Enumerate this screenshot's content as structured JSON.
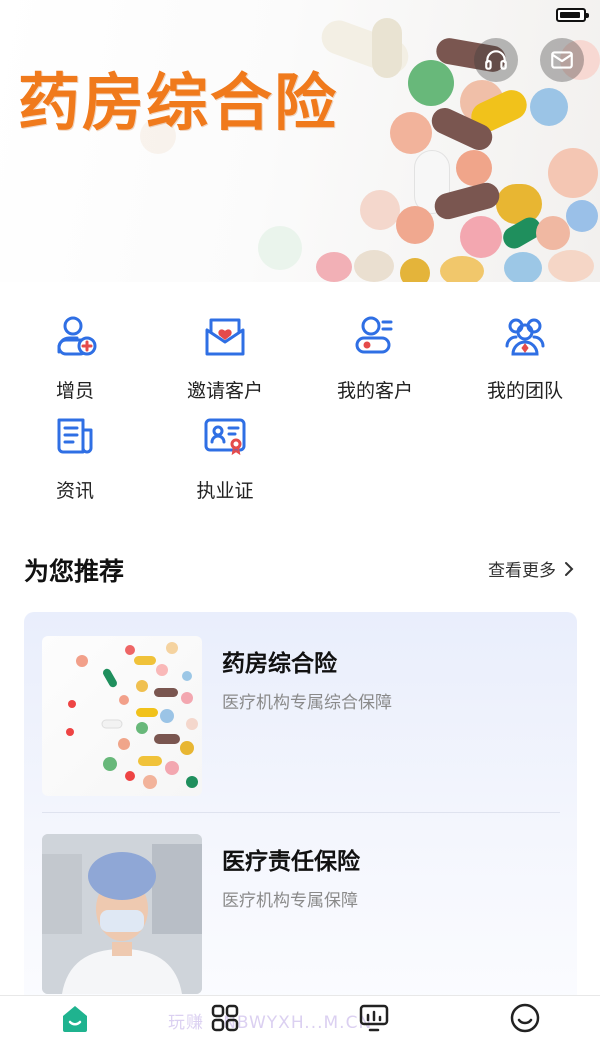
{
  "banner": {
    "title": "药房综合险",
    "headset_icon": "headset-icon",
    "mail_icon": "mail-icon"
  },
  "quick_menu": [
    {
      "label": "增员",
      "icon": "add-user-icon"
    },
    {
      "label": "邀请客户",
      "icon": "invite-envelope-icon"
    },
    {
      "label": "我的客户",
      "icon": "customer-card-icon"
    },
    {
      "label": "我的团队",
      "icon": "team-icon"
    },
    {
      "label": "资讯",
      "icon": "news-icon"
    },
    {
      "label": "执业证",
      "icon": "license-icon"
    }
  ],
  "recommend": {
    "title": "为您推荐",
    "more_label": "查看更多",
    "products": [
      {
        "name": "药房综合险",
        "desc": "医疗机构专属综合保障"
      },
      {
        "name": "医疗责任保险",
        "desc": "医疗机构专属保障"
      }
    ]
  },
  "bottom_nav": {
    "items": [
      "home-icon",
      "apps-grid-icon",
      "monitor-chart-icon",
      "smile-profile-icon"
    ],
    "watermark": "玩赚 · NBWYXH...M.CN"
  },
  "colors": {
    "accent_blue": "#2f6fe4",
    "banner_orange": "#f07a1c",
    "nav_green": "#1fb38f"
  }
}
